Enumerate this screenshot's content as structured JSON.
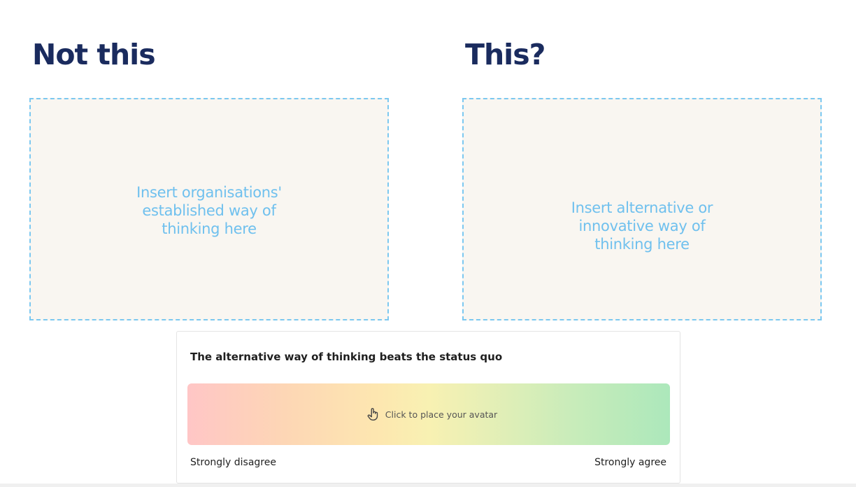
{
  "left_panel": {
    "heading": "Not this",
    "placeholder": "Insert organisations' established way of thinking here"
  },
  "right_panel": {
    "heading": "This?",
    "placeholder": "Insert alternative or innovative way of thinking here"
  },
  "poll": {
    "question": "The alternative way of thinking beats the status quo",
    "scale_prompt": "Click to place your avatar",
    "scale_icon": "hand-pointer-icon",
    "min_label": "Strongly disagree",
    "max_label": "Strongly agree",
    "colors": {
      "disagree": "#ffc6c6",
      "neutral": "#f8f1b2",
      "agree": "#ace8bb"
    }
  },
  "colors": {
    "heading": "#1a2b5e",
    "placeholder_text": "#6fc0ee",
    "placeholder_border": "#7cc8f0",
    "placeholder_bg": "#f9f6f1"
  }
}
